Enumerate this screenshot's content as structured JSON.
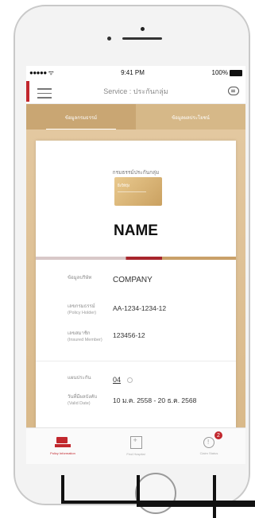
{
  "status_bar": {
    "signal": "●●●●● ",
    "wifi": "ᯤ",
    "time": "9:41 PM",
    "battery": "100%"
  },
  "header": {
    "title": "Service : ประกันกลุ่ม"
  },
  "tabs": [
    {
      "label": "ข้อมูลกรมธรรม์",
      "active": true
    },
    {
      "label": "ข้อมูลผลประโยชน์",
      "active": false
    }
  ],
  "card": {
    "heading": "กรมธรรม์ประกันกลุ่ม",
    "member_card_label": "ยิ่งให้บุ๊ง",
    "name": "NAME",
    "company_label": "ข้อมูลบริษัท",
    "company_value": "COMPANY",
    "policy_label": "เลขกรมธรรม์",
    "policy_sub": "(Policy Holder)",
    "policy_value": "AA-1234-1234-12",
    "member_label": "เลขสมาชิก",
    "member_sub": "(Insured Member)",
    "member_value": "123456-12",
    "plan_label": "แผนประกัน",
    "plan_value": "04",
    "valid_label": "วันที่มีผลบังคับ",
    "valid_sub": "(Valid Date)",
    "valid_value": "10 ม.ค. 2558 - 20 ธ.ค. 2568"
  },
  "bottom_nav": [
    {
      "label": "Policy Information",
      "icon": "policy-icon",
      "active": true
    },
    {
      "label": "Find Hospital",
      "icon": "hospital-icon",
      "active": false
    },
    {
      "label": "Claim Status",
      "icon": "claim-icon",
      "active": false,
      "badge": "2"
    }
  ],
  "colors": {
    "accent_red": "#c1272d",
    "gold": "#d6b888",
    "gold_dark": "#c9a673"
  }
}
